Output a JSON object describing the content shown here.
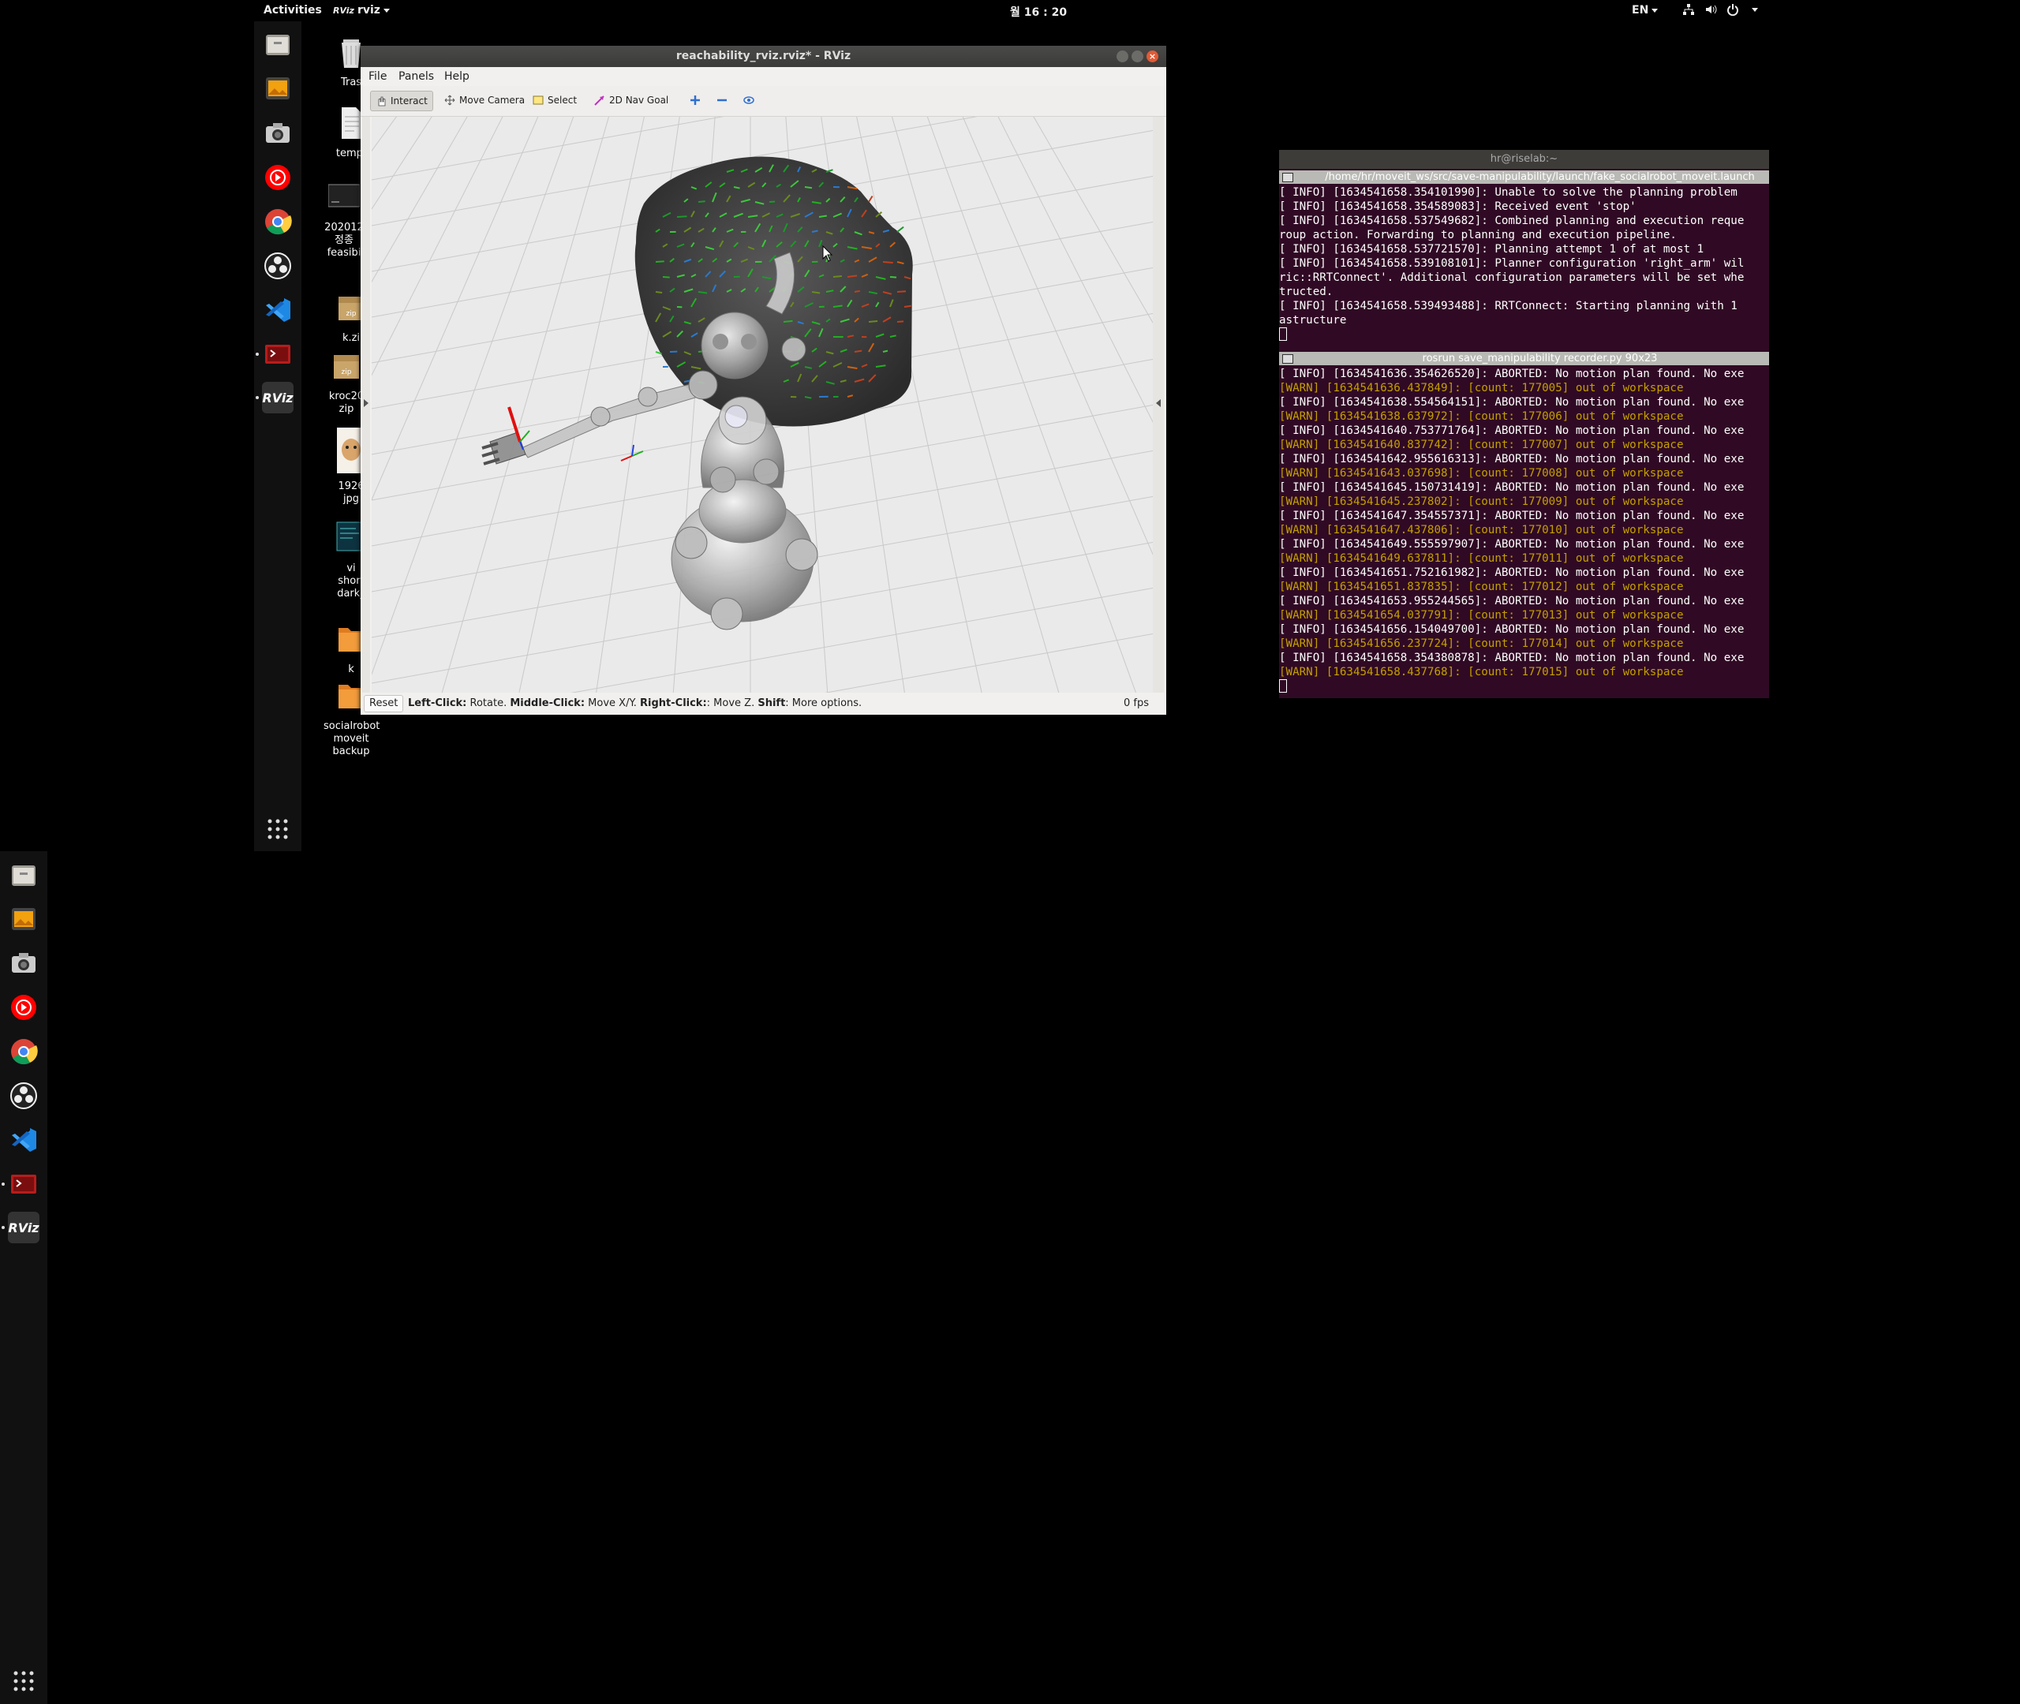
{
  "topbar": {
    "activities": "Activities",
    "app_prefix": "RViz",
    "app_name": "rviz",
    "clock": "월 16 : 20",
    "language": "EN"
  },
  "dock_items": [
    {
      "name": "files-icon"
    },
    {
      "name": "image-viewer-icon"
    },
    {
      "name": "camera-icon"
    },
    {
      "name": "youtube-music-icon"
    },
    {
      "name": "chrome-icon"
    },
    {
      "name": "obs-icon"
    },
    {
      "name": "vscode-icon"
    },
    {
      "name": "terminal-app-icon"
    },
    {
      "name": "rviz-app-icon",
      "label": "RViz"
    }
  ],
  "desktop": {
    "icons": [
      {
        "label": "Tras"
      },
      {
        "label": "temp."
      },
      {
        "label": "202012\n정종\nfeasibi"
      },
      {
        "label": "k.zi",
        "badge": "zip"
      },
      {
        "label": "kroc20\nzip",
        "badge": "zip"
      },
      {
        "label": "1926\njpg"
      },
      {
        "label": "vi\nshort\ndark_"
      },
      {
        "label": "k"
      },
      {
        "label": "socialrobot\nmoveit\nbackup"
      }
    ]
  },
  "rviz": {
    "title": "reachability_rviz.rviz* - RViz",
    "menu": {
      "file": "File",
      "panels": "Panels",
      "help": "Help"
    },
    "toolbar": {
      "interact": "Interact",
      "move_camera": "Move Camera",
      "select": "Select",
      "nav_goal": "2D Nav Goal"
    },
    "status": {
      "reset": "Reset",
      "left_click": "Left-Click:",
      "left_click_action": " Rotate. ",
      "middle_click": "Middle-Click:",
      "middle_click_action": " Move X/Y. ",
      "right_click": "Right-Click:",
      "right_click_action": ": Move Z. ",
      "shift": "Shift",
      "shift_action": ": More options.",
      "fps": "0 fps"
    }
  },
  "terminal": {
    "title": "hr@riselab:~",
    "pane1_title": "/home/hr/moveit_ws/src/save-manipulability/launch/fake_socialrobot_moveit.launch",
    "pane1_lines": [
      "[ INFO] [1634541658.354101990]: Unable to solve the planning problem",
      "[ INFO] [1634541658.354589083]: Received event 'stop'",
      "[ INFO] [1634541658.537549682]: Combined planning and execution reque",
      "roup action. Forwarding to planning and execution pipeline.",
      "[ INFO] [1634541658.537721570]: Planning attempt 1 of at most 1",
      "[ INFO] [1634541658.539108101]: Planner configuration 'right_arm' wil",
      "ric::RRTConnect'. Additional configuration parameters will be set whe",
      "tructed.",
      "[ INFO] [1634541658.539493488]: RRTConnect: Starting planning with 1",
      "astructure"
    ],
    "pane2_title": "rosrun save_manipulability recorder.py 90x23",
    "pane2_lines": [
      {
        "t": "[ INFO] [1634541636.354626520]: ABORTED: No motion plan found. No exe",
        "w": false
      },
      {
        "t": "[WARN] [1634541636.437849]: [count: 177005] out of workspace",
        "w": true
      },
      {
        "t": "[ INFO] [1634541638.554564151]: ABORTED: No motion plan found. No exe",
        "w": false
      },
      {
        "t": "[WARN] [1634541638.637972]: [count: 177006] out of workspace",
        "w": true
      },
      {
        "t": "[ INFO] [1634541640.753771764]: ABORTED: No motion plan found. No exe",
        "w": false
      },
      {
        "t": "[WARN] [1634541640.837742]: [count: 177007] out of workspace",
        "w": true
      },
      {
        "t": "[ INFO] [1634541642.955616313]: ABORTED: No motion plan found. No exe",
        "w": false
      },
      {
        "t": "[WARN] [1634541643.037698]: [count: 177008] out of workspace",
        "w": true
      },
      {
        "t": "[ INFO] [1634541645.150731419]: ABORTED: No motion plan found. No exe",
        "w": false
      },
      {
        "t": "[WARN] [1634541645.237802]: [count: 177009] out of workspace",
        "w": true
      },
      {
        "t": "[ INFO] [1634541647.354557371]: ABORTED: No motion plan found. No exe",
        "w": false
      },
      {
        "t": "[WARN] [1634541647.437806]: [count: 177010] out of workspace",
        "w": true
      },
      {
        "t": "[ INFO] [1634541649.555597907]: ABORTED: No motion plan found. No exe",
        "w": false
      },
      {
        "t": "[WARN] [1634541649.637811]: [count: 177011] out of workspace",
        "w": true
      },
      {
        "t": "[ INFO] [1634541651.752161982]: ABORTED: No motion plan found. No exe",
        "w": false
      },
      {
        "t": "[WARN] [1634541651.837835]: [count: 177012] out of workspace",
        "w": true
      },
      {
        "t": "[ INFO] [1634541653.955244565]: ABORTED: No motion plan found. No exe",
        "w": false
      },
      {
        "t": "[WARN] [1634541654.037791]: [count: 177013] out of workspace",
        "w": true
      },
      {
        "t": "[ INFO] [1634541656.154049700]: ABORTED: No motion plan found. No exe",
        "w": false
      },
      {
        "t": "[WARN] [1634541656.237724]: [count: 177014] out of workspace",
        "w": true
      },
      {
        "t": "[ INFO] [1634541658.354380878]: ABORTED: No motion plan found. No exe",
        "w": false
      },
      {
        "t": "[WARN] [1634541658.437768]: [count: 177015] out of workspace",
        "w": true
      }
    ],
    "colors": {
      "background": "#300a24",
      "warn": "#c4a000",
      "info": "#ffffff"
    }
  }
}
